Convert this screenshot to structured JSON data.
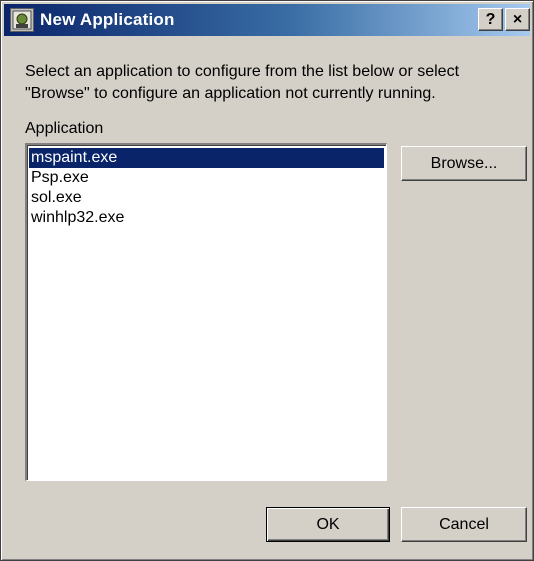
{
  "window": {
    "title": "New Application",
    "help_label": "?",
    "close_label": "×"
  },
  "description": "Select an application to configure from the list below or select \"Browse\" to configure an application not currently running.",
  "list": {
    "label": "Application",
    "items": [
      "mspaint.exe",
      "Psp.exe",
      "sol.exe",
      "winhlp32.exe"
    ],
    "selected_index": 0
  },
  "buttons": {
    "browse": "Browse...",
    "ok": "OK",
    "cancel": "Cancel"
  },
  "colors": {
    "titlebar_start": "#0a246a",
    "titlebar_end": "#a6caf0",
    "selection": "#0a246a",
    "face": "#d4d0c8"
  }
}
